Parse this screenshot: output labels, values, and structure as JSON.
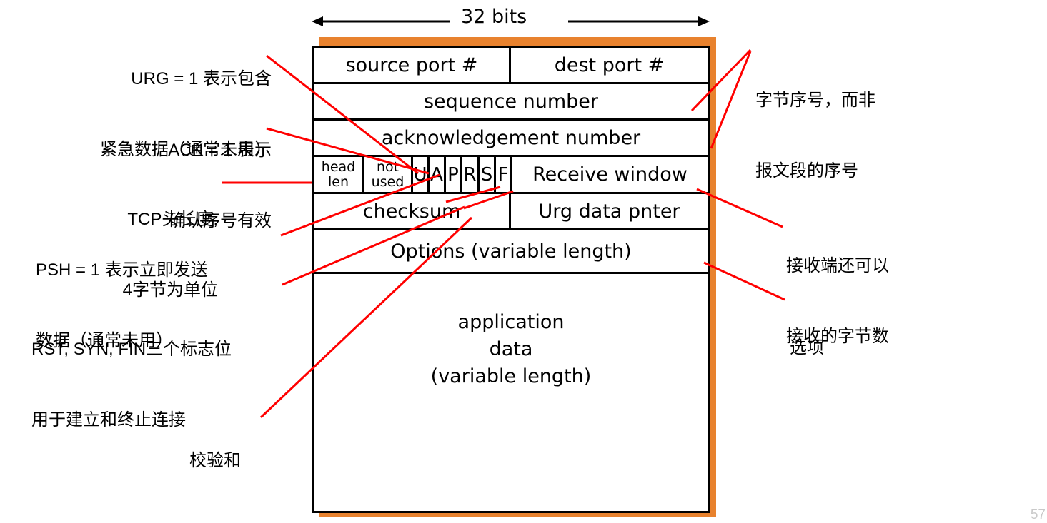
{
  "slide": {
    "page_number": "57",
    "width_label": "32 bits",
    "accent_color": "#E8822E",
    "leader_color": "#FF0000"
  },
  "header_table": {
    "rows": [
      {
        "id": "ports",
        "cells": [
          {
            "label": "source port #"
          },
          {
            "label": "dest port #"
          }
        ]
      },
      {
        "id": "sequence",
        "cells": [
          {
            "label": "sequence number"
          }
        ]
      },
      {
        "id": "acknowledgement",
        "cells": [
          {
            "label": "acknowledgement number"
          }
        ]
      },
      {
        "id": "flags",
        "cells": [
          {
            "label": "head",
            "label2": "len"
          },
          {
            "label": "not",
            "label2": "used"
          },
          {
            "label": "U"
          },
          {
            "label": "A"
          },
          {
            "label": "P"
          },
          {
            "label": "R"
          },
          {
            "label": "S"
          },
          {
            "label": "F"
          },
          {
            "label": "Receive window"
          }
        ]
      },
      {
        "id": "checksum",
        "cells": [
          {
            "label": "checksum"
          },
          {
            "label": "Urg data pnter"
          }
        ]
      },
      {
        "id": "options",
        "cells": [
          {
            "label": "Options (variable length)"
          }
        ]
      },
      {
        "id": "payload",
        "cells": [
          {
            "label": "application",
            "label2": "data",
            "label3": "(variable length)"
          }
        ]
      }
    ]
  },
  "annotations": {
    "left": [
      {
        "id": "urg",
        "line1": "URG = 1 表示包含",
        "line2": "紧急数据（通常未用）"
      },
      {
        "id": "ack",
        "line1": "ACK = 1 表示",
        "line2": "确认序号有效"
      },
      {
        "id": "headlen",
        "line1": "TCP头长度,",
        "line2": "4字节为单位"
      },
      {
        "id": "psh",
        "line1": "PSH = 1 表示立即发送",
        "line2": "数据（通常未用）"
      },
      {
        "id": "rst-syn-fin",
        "line1": "RST, SYN, FIN三个标志位",
        "line2": "用于建立和终止连接"
      },
      {
        "id": "checksum",
        "line1": "校验和",
        "line2": ""
      }
    ],
    "right": [
      {
        "id": "seq-byte",
        "line1": "字节序号，而非",
        "line2": "报文段的序号"
      },
      {
        "id": "recv-window",
        "line1": "接收端还可以",
        "line2": "接收的字节数"
      },
      {
        "id": "options",
        "line1": "选项",
        "line2": ""
      }
    ]
  }
}
